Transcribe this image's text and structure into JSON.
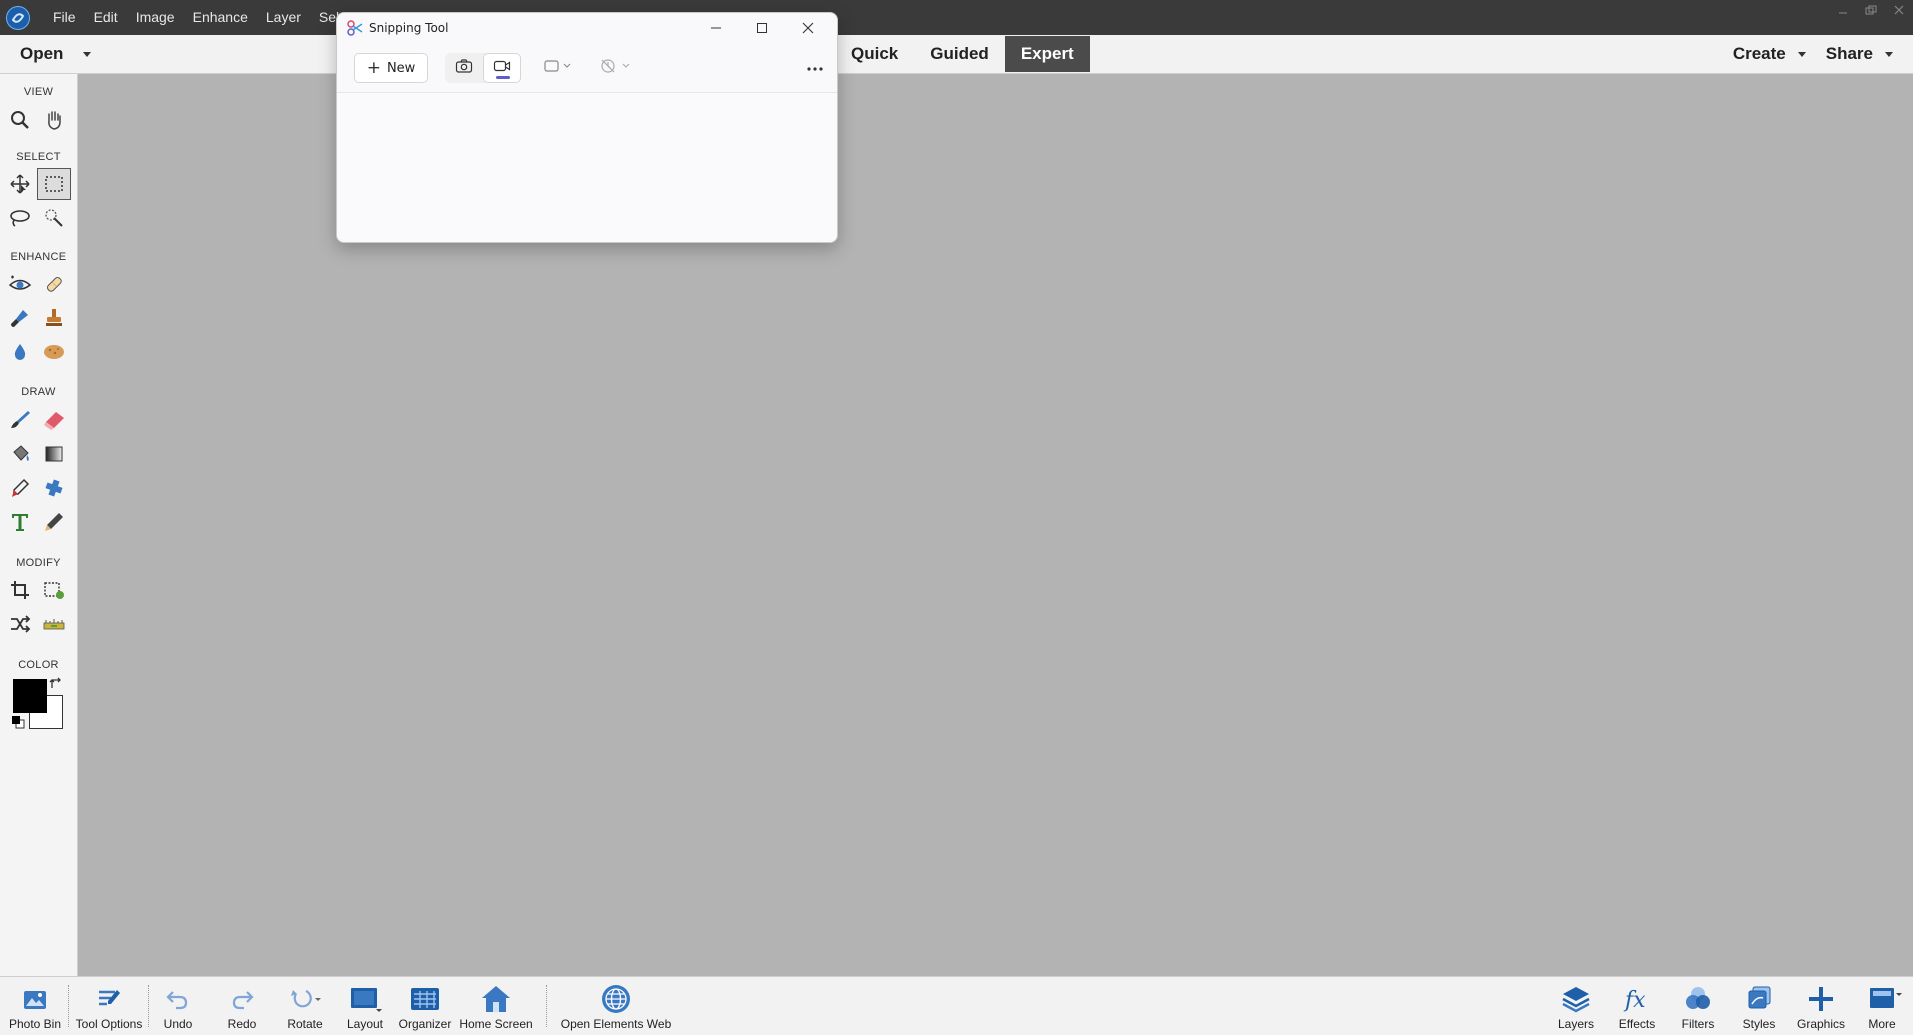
{
  "menubar": {
    "items": [
      "File",
      "Edit",
      "Image",
      "Enhance",
      "Layer",
      "Select"
    ]
  },
  "modebar": {
    "open_label": "Open",
    "modes": [
      {
        "label": "Quick",
        "active": false
      },
      {
        "label": "Guided",
        "active": false
      },
      {
        "label": "Expert",
        "active": true
      }
    ],
    "create_label": "Create",
    "share_label": "Share"
  },
  "toolbar": {
    "sections": {
      "view": "VIEW",
      "select": "SELECT",
      "enhance": "ENHANCE",
      "draw": "DRAW",
      "modify": "MODIFY",
      "color": "COLOR"
    },
    "tools": [
      {
        "name": "zoom-tool-icon"
      },
      {
        "name": "hand-tool-icon"
      },
      {
        "name": "move-tool-icon"
      },
      {
        "name": "rectangular-marquee-icon",
        "active": true
      },
      {
        "name": "lasso-tool-icon"
      },
      {
        "name": "quick-selection-icon"
      },
      {
        "name": "red-eye-tool-icon"
      },
      {
        "name": "spot-healing-icon"
      },
      {
        "name": "smart-brush-icon"
      },
      {
        "name": "clone-stamp-icon"
      },
      {
        "name": "blur-tool-icon"
      },
      {
        "name": "sponge-tool-icon"
      },
      {
        "name": "brush-tool-icon"
      },
      {
        "name": "eraser-tool-icon"
      },
      {
        "name": "paint-bucket-icon"
      },
      {
        "name": "gradient-tool-icon"
      },
      {
        "name": "eyedropper-icon"
      },
      {
        "name": "custom-shape-icon"
      },
      {
        "name": "type-tool-icon"
      },
      {
        "name": "pencil-tool-icon"
      },
      {
        "name": "crop-tool-icon"
      },
      {
        "name": "recompose-tool-icon"
      },
      {
        "name": "content-aware-move-icon"
      },
      {
        "name": "straighten-tool-icon"
      }
    ],
    "colors": {
      "foreground": "#000000",
      "background": "#ffffff"
    }
  },
  "bottombar": {
    "left": [
      {
        "label": "Photo Bin",
        "icon": "photo-bin-icon"
      },
      {
        "label": "Tool Options",
        "icon": "tool-options-icon"
      },
      {
        "label": "Undo",
        "icon": "undo-icon"
      },
      {
        "label": "Redo",
        "icon": "redo-icon"
      },
      {
        "label": "Rotate",
        "icon": "rotate-icon"
      },
      {
        "label": "Layout",
        "icon": "layout-icon"
      },
      {
        "label": "Organizer",
        "icon": "organizer-icon"
      },
      {
        "label": "Home Screen",
        "icon": "home-icon"
      },
      {
        "label": "Open Elements Web",
        "icon": "globe-icon"
      }
    ],
    "right": [
      {
        "label": "Layers",
        "icon": "layers-icon"
      },
      {
        "label": "Effects",
        "icon": "effects-icon"
      },
      {
        "label": "Filters",
        "icon": "filters-icon"
      },
      {
        "label": "Styles",
        "icon": "styles-icon"
      },
      {
        "label": "Graphics",
        "icon": "graphics-icon"
      },
      {
        "label": "More",
        "icon": "more-panels-icon"
      }
    ]
  },
  "snipping_tool": {
    "title": "Snipping Tool",
    "new_label": "New",
    "modes": [
      {
        "icon": "camera-icon",
        "selected": false
      },
      {
        "icon": "video-icon",
        "selected": true
      }
    ],
    "shape_dropdown_icon": "rectangle-mode-icon",
    "delay_dropdown_icon": "no-delay-icon",
    "accent": "#5b5fc7"
  }
}
